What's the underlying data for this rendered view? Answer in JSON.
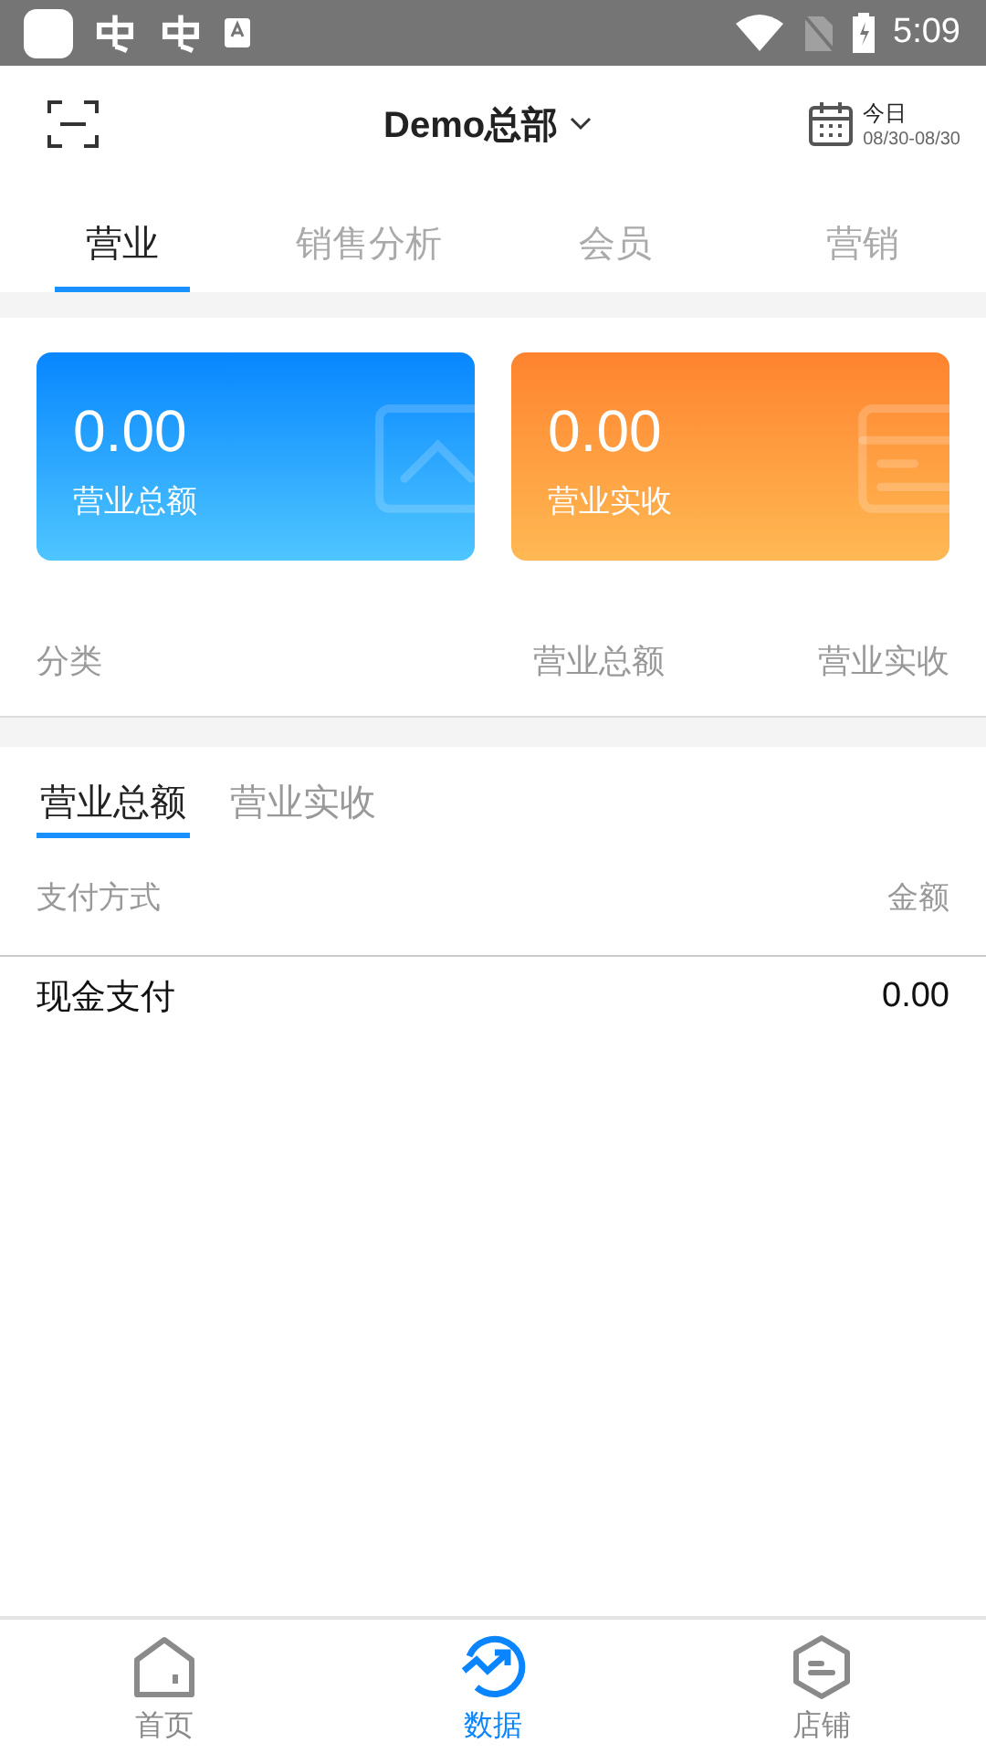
{
  "status_bar": {
    "time": "5:09"
  },
  "header": {
    "title": "Demo总部",
    "date_label": "今日",
    "date_range": "08/30-08/30"
  },
  "tabs": [
    {
      "label": "营业",
      "selected": true
    },
    {
      "label": "销售分析",
      "selected": false
    },
    {
      "label": "会员",
      "selected": false
    },
    {
      "label": "营销",
      "selected": false
    }
  ],
  "cards": [
    {
      "kind": "chart",
      "value": "0.00",
      "label": "营业总额"
    },
    {
      "kind": "list",
      "value": "0.00",
      "label": "营业实收"
    }
  ],
  "category_table": {
    "columns": [
      "分类",
      "营业总额",
      "营业实收"
    ]
  },
  "sub_tabs": [
    {
      "label": "营业总额",
      "selected": true
    },
    {
      "label": "营业实收",
      "selected": false
    }
  ],
  "payment_table": {
    "columns": [
      "支付方式",
      "金额"
    ],
    "rows": [
      {
        "method": "现金支付",
        "amount": "0.00"
      }
    ]
  },
  "bottom_nav": [
    {
      "kind": "home",
      "label": "首页",
      "selected": false
    },
    {
      "kind": "data",
      "label": "数据",
      "selected": true
    },
    {
      "kind": "shop",
      "label": "店铺",
      "selected": false
    }
  ]
}
